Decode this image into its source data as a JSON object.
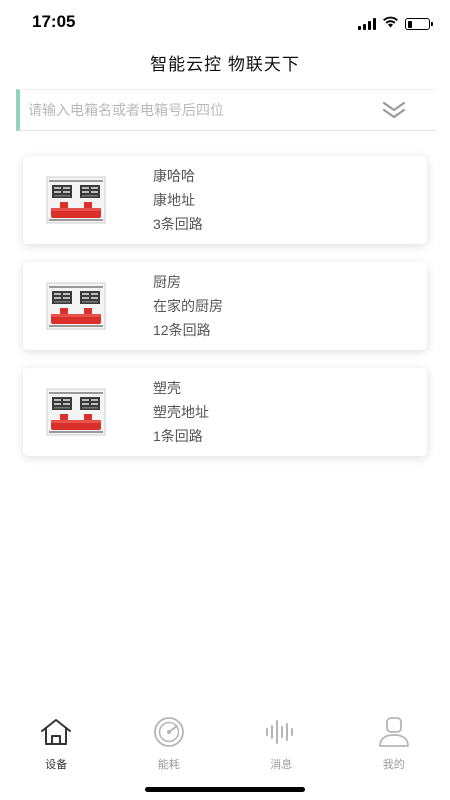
{
  "status_bar": {
    "time": "17:05",
    "icons": [
      "signal-icon",
      "wifi-icon",
      "battery-icon"
    ],
    "battery_level": 0.2
  },
  "header": {
    "title": "智能云控 物联天下"
  },
  "search": {
    "placeholder": "请输入电箱名或者电箱号后四位",
    "value": "",
    "accent_color": "#8fd3c3",
    "toggle_icon": "double-chevron-down-icon"
  },
  "devices": [
    {
      "name": "康哈哈",
      "address": "康地址",
      "circuits": "3条回路",
      "icon": "electric-box-icon"
    },
    {
      "name": "厨房",
      "address": "在家的厨房",
      "circuits": "12条回路",
      "icon": "electric-box-icon"
    },
    {
      "name": "塑壳",
      "address": "塑壳地址",
      "circuits": "1条回路",
      "icon": "electric-box-icon"
    }
  ],
  "tab_bar": {
    "active": "设备",
    "tabs": [
      {
        "label": "设备",
        "icon": "home-icon"
      },
      {
        "label": "能耗",
        "icon": "gauge-icon"
      },
      {
        "label": "消息",
        "icon": "sound-wave-icon"
      },
      {
        "label": "我的",
        "icon": "user-icon"
      }
    ]
  },
  "colors": {
    "accent": "#8fd3c3",
    "device_red": "#d9302c",
    "tab_active": "#333333",
    "tab_inactive": "#9a9a9a"
  }
}
